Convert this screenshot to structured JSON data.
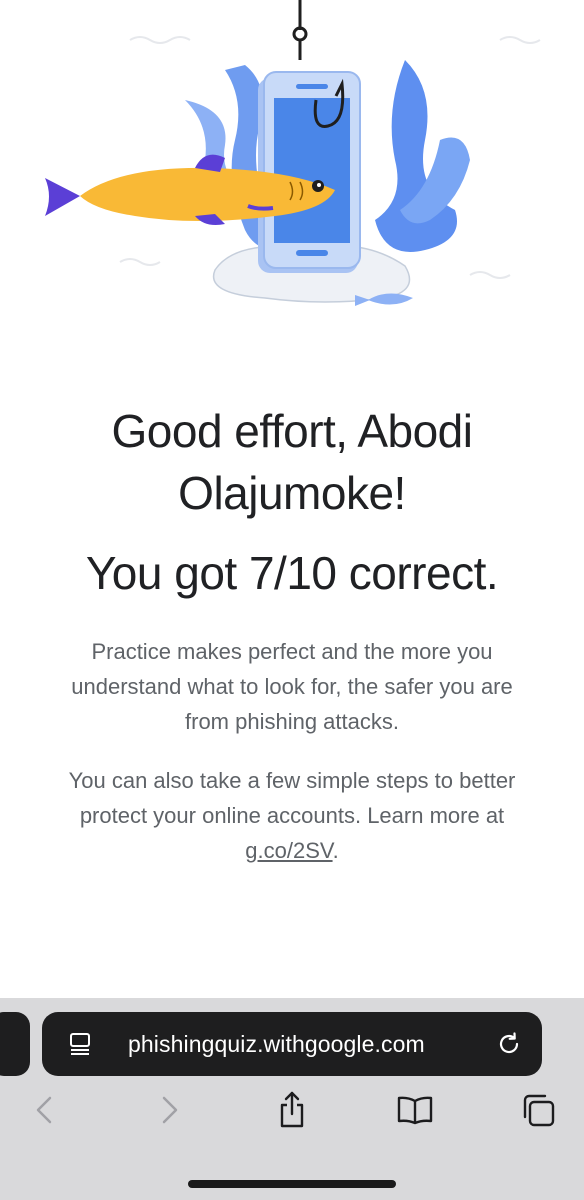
{
  "result": {
    "greeting": "Good effort, Abodi Olajumoke!",
    "score": "You got 7/10 correct.",
    "paragraph_1": "Practice makes perfect and the more you understand what to look for, the safer you are from phishing attacks.",
    "paragraph_2_prefix": "You can also take a few simple steps to better protect your online accounts. Learn more at ",
    "paragraph_2_link": "g.co/2SV",
    "paragraph_2_suffix": "."
  },
  "browser": {
    "url": "phishingquiz.withgoogle.com",
    "page_menu_icon": "page-format-icon",
    "reload_icon": "reload-icon",
    "toolbar": [
      {
        "name": "back-button",
        "icon": "chevron-left-icon",
        "enabled": false
      },
      {
        "name": "forward-button",
        "icon": "chevron-right-icon",
        "enabled": false
      },
      {
        "name": "share-button",
        "icon": "share-icon",
        "enabled": true
      },
      {
        "name": "bookmarks-button",
        "icon": "book-icon",
        "enabled": true
      },
      {
        "name": "tabs-button",
        "icon": "tabs-icon",
        "enabled": true
      }
    ]
  },
  "colors": {
    "headline": "#202124",
    "body_text": "#5f6368",
    "chrome_bg": "#d9d9db",
    "urlbar_bg": "#1e1e1f",
    "fish_yellow": "#f9b936",
    "fish_fin_purple": "#5b3fd6",
    "phone_blue": "#4a86e8",
    "seaweed_blue": "#5e8ff0"
  }
}
